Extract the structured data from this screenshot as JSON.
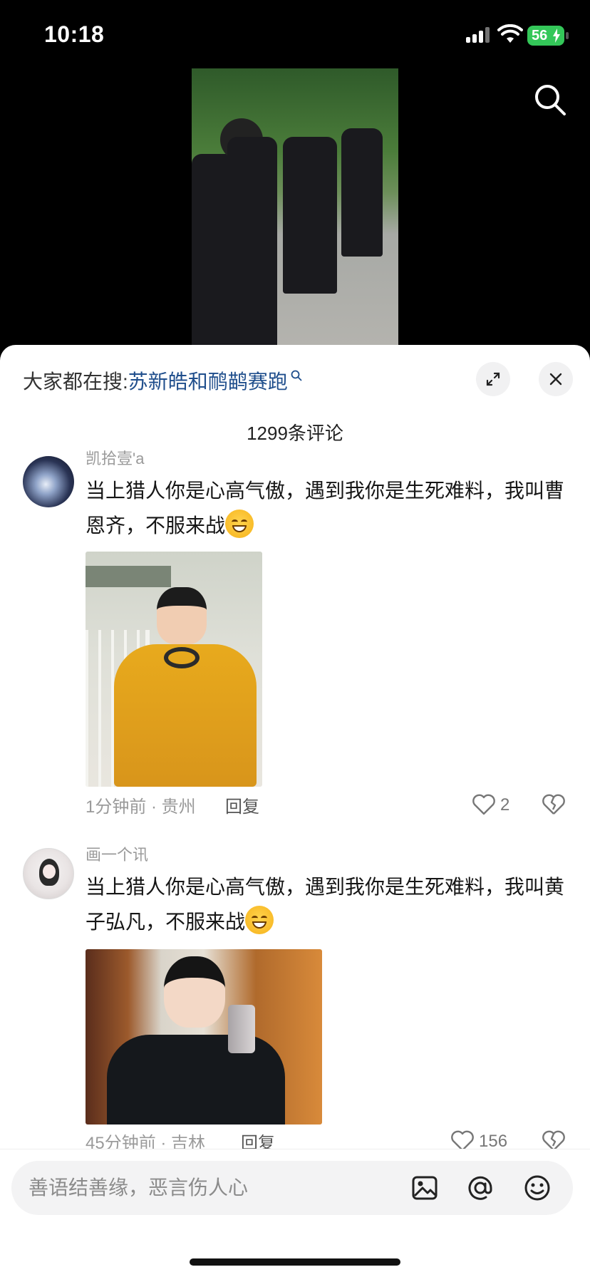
{
  "status_bar": {
    "time": "10:18",
    "battery": "56"
  },
  "trending": {
    "prefix": "大家都在搜:",
    "query": "苏新皓和鸸鹋赛跑"
  },
  "comment_count": "1299条评论",
  "comments": [
    {
      "username": "凯拾壹'a",
      "text": "当上猎人你是心高气傲，遇到我你是生死难料，我叫曹恩齐，不服来战",
      "emoji": "grin-emoji",
      "time_location": "1分钟前 · 贵州",
      "reply_label": "回复",
      "likes": "2"
    },
    {
      "username": "画一个讯",
      "text": "当上猎人你是心高气傲，遇到我你是生死难料，我叫黄子弘凡，不服来战",
      "emoji": "grin-emoji",
      "time_location": "45分钟前 · 吉林",
      "reply_label": "回复",
      "likes": "156"
    }
  ],
  "input": {
    "placeholder": "善语结善缘，恶言伤人心"
  },
  "icons": [
    "search-icon",
    "expand-icon",
    "close-icon",
    "heart-icon",
    "broken-heart-icon",
    "image-icon",
    "at-icon",
    "emoji-icon"
  ]
}
